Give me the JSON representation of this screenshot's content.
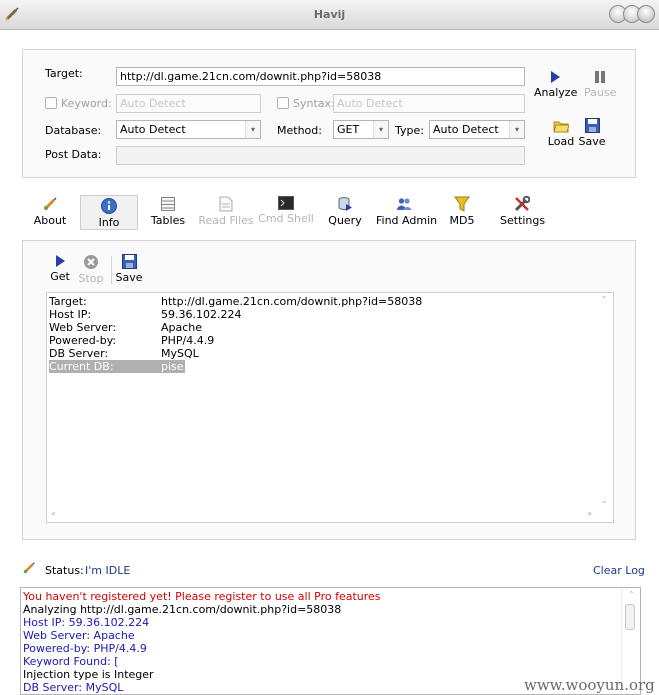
{
  "window": {
    "title": "Havij"
  },
  "target_panel": {
    "target_label": "Target:",
    "target_value": "http://dl.game.21cn.com/downit.php?id=58038",
    "keyword_label": "Keyword:",
    "keyword_placeholder": "Auto Detect",
    "syntax_label": "Syntax:",
    "syntax_placeholder": "Auto Detect",
    "database_label": "Database:",
    "database_value": "Auto Detect",
    "method_label": "Method:",
    "method_value": "GET",
    "type_label": "Type:",
    "type_value": "Auto Detect",
    "postdata_label": "Post Data:",
    "postdata_value": ""
  },
  "actions": {
    "analyze": "Analyze",
    "pause": "Pause",
    "load": "Load",
    "save": "Save"
  },
  "tabs": [
    {
      "label": "About"
    },
    {
      "label": "Info"
    },
    {
      "label": "Tables"
    },
    {
      "label": "Read Files"
    },
    {
      "label": "Cmd Shell"
    },
    {
      "label": "Query"
    },
    {
      "label": "Find Admin"
    },
    {
      "label": "MD5"
    },
    {
      "label": "Settings"
    }
  ],
  "info_toolbar": {
    "get": "Get",
    "stop": "Stop",
    "save": "Save"
  },
  "info": {
    "rows": [
      {
        "key": "Target:",
        "value": "http://dl.game.21cn.com/downit.php?id=58038"
      },
      {
        "key": "Host IP:",
        "value": "59.36.102.224"
      },
      {
        "key": "Web Server:",
        "value": "Apache"
      },
      {
        "key": "Powered-by:",
        "value": "PHP/4.4.9"
      },
      {
        "key": "DB Server:",
        "value": "MySQL"
      },
      {
        "key": "Current DB:",
        "value": "pise"
      }
    ]
  },
  "status": {
    "label": "Status:",
    "value": "I'm IDLE",
    "clear_log": "Clear Log"
  },
  "log": {
    "lines": [
      {
        "text": "You haven't registered yet! Please register to use all Pro features",
        "color": "red"
      },
      {
        "text": "Analyzing http://dl.game.21cn.com/downit.php?id=58038",
        "color": "black"
      },
      {
        "text": "Host IP: 59.36.102.224",
        "color": "blue"
      },
      {
        "text": "Web Server: Apache",
        "color": "blue"
      },
      {
        "text": "Powered-by: PHP/4.4.9",
        "color": "blue"
      },
      {
        "text": "Keyword Found: [",
        "color": "blue"
      },
      {
        "text": "Injection type is Integer",
        "color": "black"
      },
      {
        "text": "DB Server: MySQL",
        "color": "blue"
      }
    ]
  },
  "watermark": "www.wooyun.org",
  "colors": {
    "log_red": "#d40000",
    "log_blue": "#1a1ab0",
    "link_blue": "#1c3a8c",
    "selection_gray": "#b0b0b0"
  }
}
